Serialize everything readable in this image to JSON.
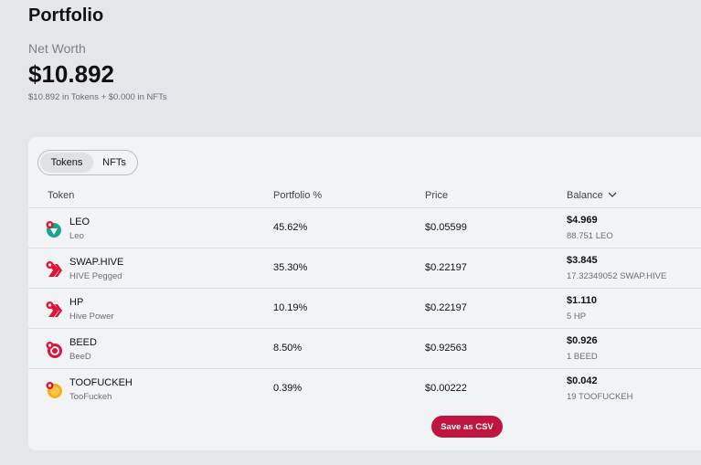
{
  "header": {
    "title": "Portfolio",
    "net_worth_label": "Net Worth",
    "net_worth_value": "$10.892",
    "net_worth_breakdown": "$10.892 in Tokens + $0.000 in NFTs"
  },
  "tabs": [
    {
      "label": "Tokens",
      "active": true
    },
    {
      "label": "NFTs",
      "active": false
    }
  ],
  "table": {
    "columns": {
      "token": "Token",
      "portfolio": "Portfolio %",
      "price": "Price",
      "balance": "Balance"
    },
    "rows": [
      {
        "symbol": "LEO",
        "name": "Leo",
        "portfolio": "45.62%",
        "price": "$0.05599",
        "balance": "$4.969",
        "amount": "88.751 LEO",
        "icon": "leo-icon"
      },
      {
        "symbol": "SWAP.HIVE",
        "name": "HIVE Pegged",
        "portfolio": "35.30%",
        "price": "$0.22197",
        "balance": "$3.845",
        "amount": "17.32349052 SWAP.HIVE",
        "icon": "hive-icon"
      },
      {
        "symbol": "HP",
        "name": "Hive Power",
        "portfolio": "10.19%",
        "price": "$0.22197",
        "balance": "$1.110",
        "amount": "5 HP",
        "icon": "hive-icon"
      },
      {
        "symbol": "BEED",
        "name": "BeeD",
        "portfolio": "8.50%",
        "price": "$0.92563",
        "balance": "$0.926",
        "amount": "1 BEED",
        "icon": "beed-icon"
      },
      {
        "symbol": "TOOFUCKEH",
        "name": "TooFuckeh",
        "portfolio": "0.39%",
        "price": "$0.00222",
        "balance": "$0.042",
        "amount": "19 TOOFUCKEH",
        "icon": "toofuckeh-icon"
      }
    ]
  },
  "actions": {
    "save_csv": "Save as CSV"
  },
  "colors": {
    "accent": "#c0163e",
    "hive_red": "#e31337",
    "leo_teal": "#1aa38f",
    "coin_yellow": "#f2b01e"
  }
}
